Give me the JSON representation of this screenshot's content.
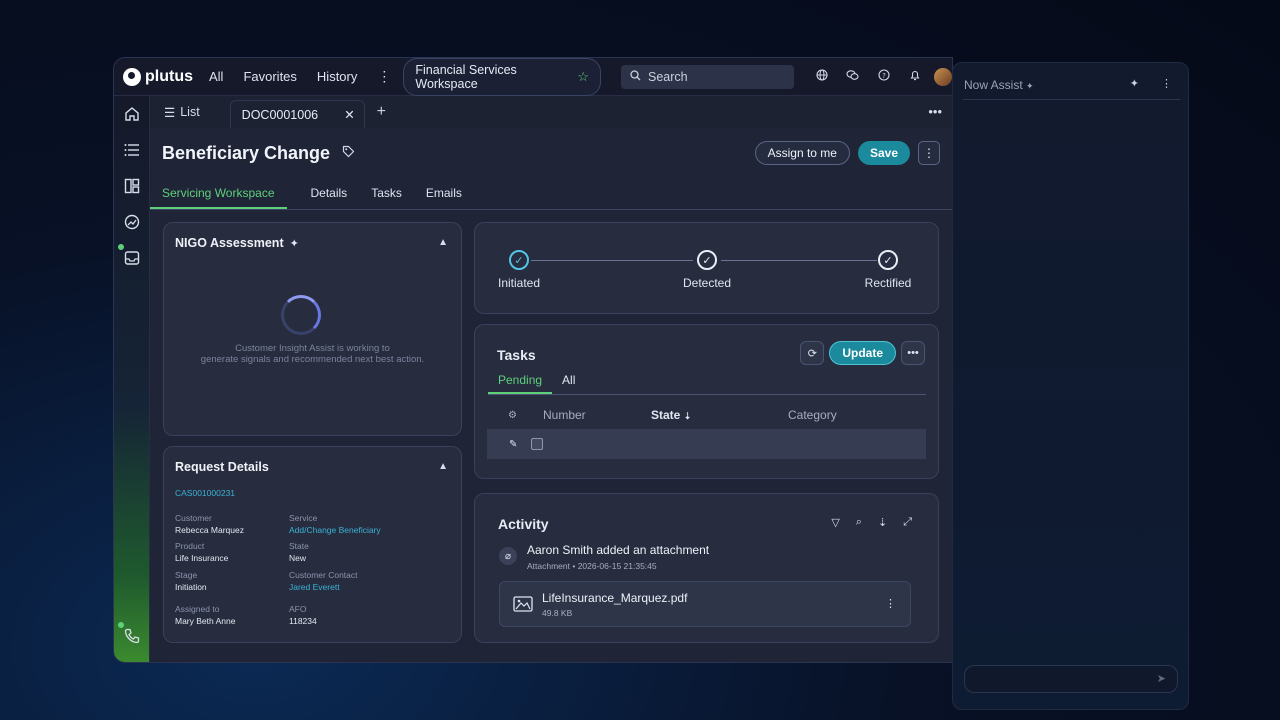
{
  "app": {
    "brand": "plutus",
    "accent": "#1b8a9c",
    "active_color": "#5ed07a"
  },
  "topnav": {
    "items": [
      "All",
      "Favorites",
      "History"
    ],
    "more": "⋮",
    "workspace": "Financial Services Workspace",
    "search_placeholder": "Search",
    "icons": [
      "globe-icon",
      "chat-icon",
      "help-icon",
      "bell-icon",
      "avatar"
    ]
  },
  "tabs": {
    "list_label": "List",
    "active_doc": "DOC0001006"
  },
  "record": {
    "title": "Beneficiary Change",
    "assign_label": "Assign to me",
    "save_label": "Save",
    "subtabs": [
      "Servicing Workspace",
      "Details",
      "Tasks",
      "Emails"
    ]
  },
  "nigo": {
    "title": "NIGO Assessment",
    "message_line1": "Customer Insight Assist is working to",
    "message_line2": "generate signals and recommended next best action."
  },
  "request": {
    "title": "Request Details",
    "case_number": "CAS001000231",
    "fields": [
      {
        "label": "Customer",
        "value": "Rebecca Marquez",
        "link": false
      },
      {
        "label": "Service",
        "value": "Add/Change Beneficiary",
        "link": true
      },
      {
        "label": "Product",
        "value": "Life Insurance",
        "link": false
      },
      {
        "label": "State",
        "value": "New",
        "link": false
      },
      {
        "label": "Stage",
        "value": "Initiation",
        "link": false
      },
      {
        "label": "Customer Contact",
        "value": "Jared Everett",
        "link": true
      },
      {
        "label": "Assigned to",
        "value": "Mary Beth Anne",
        "link": false
      },
      {
        "label": "AFO",
        "value": "118234",
        "link": false
      }
    ]
  },
  "progress": {
    "steps": [
      "Initiated",
      "Detected",
      "Rectified"
    ]
  },
  "tasks": {
    "title": "Tasks",
    "update_label": "Update",
    "tabs": [
      "Pending",
      "All"
    ],
    "columns": [
      "Number",
      "State",
      "Category"
    ]
  },
  "activity": {
    "title": "Activity",
    "entry_text": "Aaron Smith added an attachment",
    "entry_meta": "Attachment  •  2026-06-15 21:35:45",
    "file_name": "LifeInsurance_Marquez.pdf",
    "file_size": "49.8 KB"
  },
  "assist": {
    "title": "Now Assist"
  }
}
